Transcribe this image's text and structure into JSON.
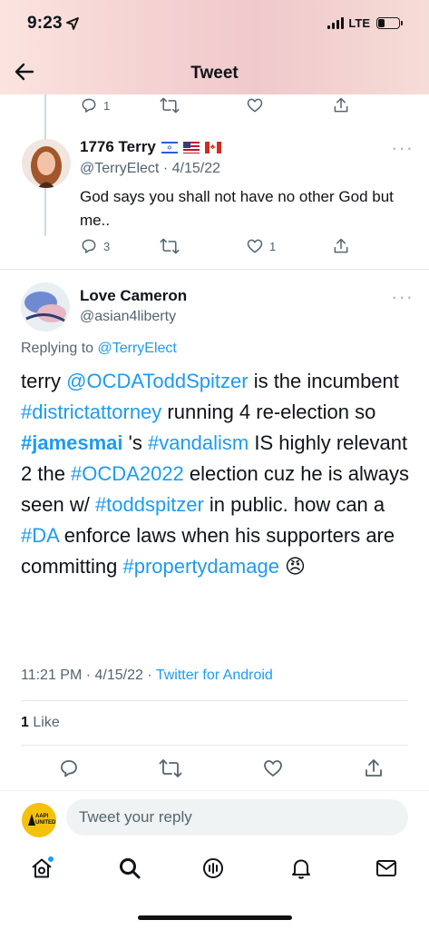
{
  "status": {
    "time": "9:23",
    "network": "LTE"
  },
  "header": {
    "title": "Tweet"
  },
  "top_actions": {
    "reply_count": "1"
  },
  "reply_tweet": {
    "name": "1776 Terry",
    "handle": "@TerryElect",
    "date": "4/15/22",
    "text": "God says you shall not have no other God but me..",
    "reply_count": "3",
    "like_count": "1"
  },
  "main_tweet": {
    "name": "Love Cameron",
    "handle": "@asian4liberty",
    "replying_label": "Replying to",
    "replying_to": "@TerryElect",
    "text": {
      "p1": "terry ",
      "m1": "@OCDATodd­Spitzer",
      "p2": " is the incumbent ",
      "t1": "#districtattorney",
      "p3": " running 4 re-election so ",
      "t2": "#jamesmai",
      "p4": " 's ",
      "t3": "#vandalism",
      "p5": " IS highly relevant 2 the ",
      "t4": "#OCDA2022",
      "p6": " election cuz he is always seen w/ ",
      "t5": "#toddspitzer",
      "p7": " in public. how can a ",
      "t6": "#DA",
      "p8": " enforce laws when his supporters are committing ",
      "t7": "#propertydamage",
      "emoji": " 😠"
    },
    "time": "11:21 PM",
    "date": "4/15/22",
    "source": "Twitter for Android",
    "likes_count": "1",
    "likes_label": "Like"
  },
  "reply_box": {
    "placeholder": "Tweet your reply",
    "avatar_text": "AAPI UNITED"
  },
  "colors": {
    "accent": "#1d9bf0",
    "grey": "#536471"
  }
}
